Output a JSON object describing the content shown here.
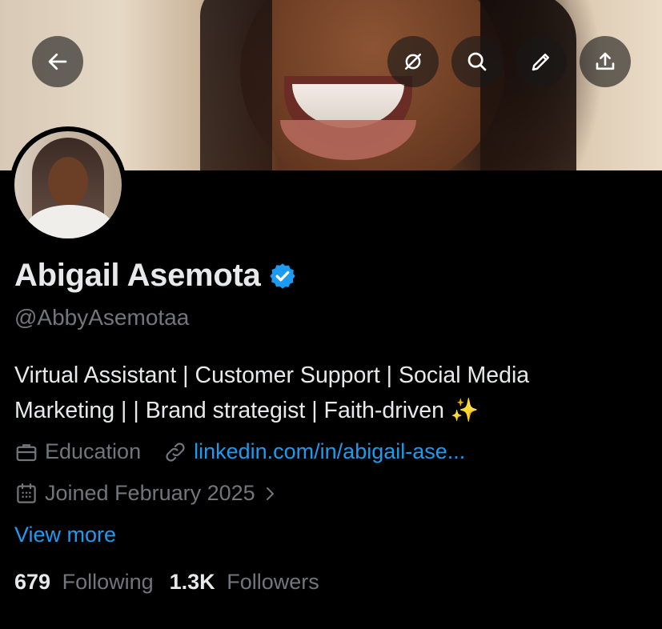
{
  "header": {
    "back_icon": "arrow-left-icon",
    "actions": [
      {
        "icon": "grok-icon"
      },
      {
        "icon": "search-icon"
      },
      {
        "icon": "pencil-icon"
      },
      {
        "icon": "share-icon"
      }
    ]
  },
  "profile": {
    "name": "Abigail Asemota",
    "verified": true,
    "handle": "@AbbyAsemotaa",
    "bio_line1": "Virtual Assistant | Customer Support | Social Media",
    "bio_line2": "Marketing | | Brand strategist | Faith-driven ✨",
    "category": "Education",
    "website": "linkedin.com/in/abigail-ase...",
    "joined": "Joined February 2025",
    "view_more": "View more",
    "following_count": "679",
    "following_label": "Following",
    "followers_count": "1.3K",
    "followers_label": "Followers"
  },
  "colors": {
    "background": "#000000",
    "text_primary": "#e7e9ea",
    "text_secondary": "#71767b",
    "accent": "#1d9bf0"
  }
}
